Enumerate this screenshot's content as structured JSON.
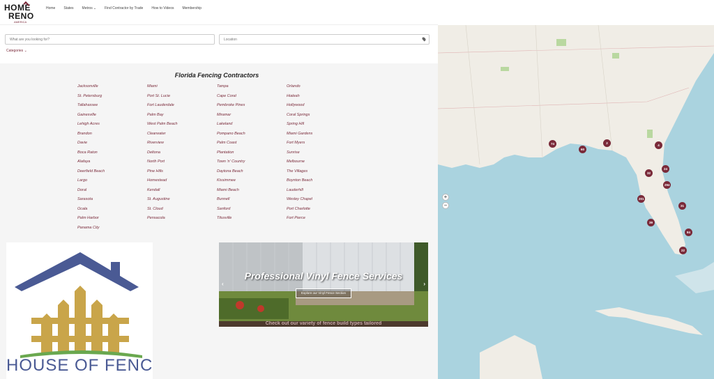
{
  "header": {
    "logo": {
      "line1": "HOME",
      "line2": "RENO",
      "line3": "AMERICA"
    },
    "nav": [
      {
        "label": "Home",
        "has_dropdown": false
      },
      {
        "label": "States",
        "has_dropdown": false
      },
      {
        "label": "Metros",
        "has_dropdown": true
      },
      {
        "label": "Find Contractor by Trade",
        "has_dropdown": false
      },
      {
        "label": "How to Videos",
        "has_dropdown": false
      },
      {
        "label": "Membership",
        "has_dropdown": false
      }
    ]
  },
  "search": {
    "keyword_placeholder": "What are you looking for?",
    "location_placeholder": "Location",
    "categories_label": "Categories"
  },
  "section": {
    "title": "Florida Fencing Contractors",
    "cities": [
      "Jacksonville",
      "Miami",
      "Tampa",
      "Orlando",
      "St. Petersburg",
      "Port St. Lucie",
      "Cape Coral",
      "Hialeah",
      "Tallahassee",
      "Fort Lauderdale",
      "Pembroke Pines",
      "Hollywood",
      "Gainesville",
      "Palm Bay",
      "Miramar",
      "Coral Springs",
      "Lehigh Acres",
      "West Palm Beach",
      "Lakeland",
      "Spring Hill",
      "Brandon",
      "Clearwater",
      "Pompano Beach",
      "Miami Gardens",
      "Davie",
      "Riverview",
      "Palm Coast",
      "Fort Myers",
      "Boca Raton",
      "Deltona",
      "Plantation",
      "Sunrise",
      "Alafaya",
      "North Port",
      "Town 'n' Country",
      "Melbourne",
      "Deerfield Beach",
      "Pine Hills",
      "Daytona Beach",
      "The Villages",
      "Largo",
      "Homestead",
      "Kissimmee",
      "Boynton Beach",
      "Doral",
      "Kendall",
      "Miami Beach",
      "Lauderhill",
      "Sarasota",
      "St. Augustine",
      "Bunnell",
      "Wesley Chapel",
      "Ocala",
      "St. Cloud",
      "Sanford",
      "Port Charlotte",
      "Palm Harbor",
      "Pensacola",
      "Titusville",
      "Fort Pierce",
      "Panama City"
    ]
  },
  "promo": {
    "logo_text": "HOUSE OF FENCES",
    "slide_title": "Professional Vinyl Fence Services",
    "slide_button": "Explore our Vinyl Fence Section",
    "slide_subtext": "Check out our variety of fence build types tailored"
  },
  "map": {
    "zoom_in": "+",
    "zoom_out": "−",
    "markers": [
      "74",
      "60",
      "2",
      "4",
      "24",
      "32",
      "294",
      "201",
      "31",
      "39",
      "84",
      "22"
    ]
  }
}
